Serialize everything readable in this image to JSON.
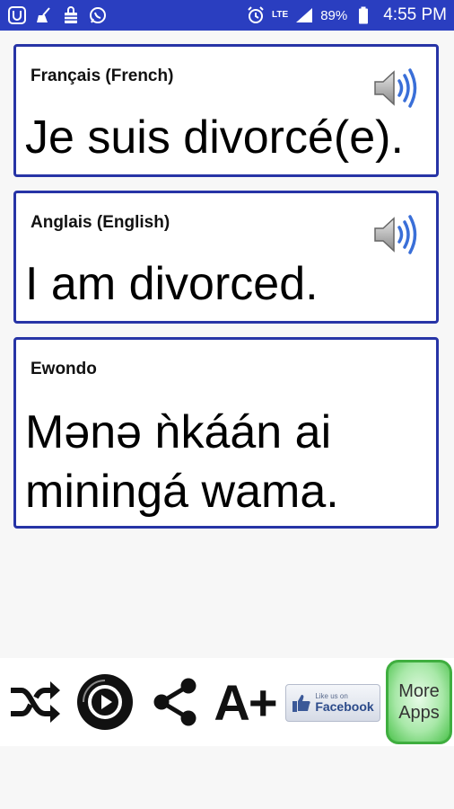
{
  "status_bar": {
    "battery_percent": "89%",
    "network": "LTE",
    "time": "4:55 PM"
  },
  "cards": [
    {
      "label": "Français (French)",
      "text": "Je suis divorcé(e).",
      "has_audio": true
    },
    {
      "label": "Anglais (English)",
      "text": "I am divorced.",
      "has_audio": true
    },
    {
      "label": "Ewondo",
      "text_line1": "Mənə ǹkáán ai",
      "text_line2": "miningá wama.",
      "has_audio": false
    }
  ],
  "toolbar": {
    "facebook_small": "Like us on",
    "facebook_big": "Facebook",
    "more_apps_line1": "More",
    "more_apps_line2": "Apps",
    "font_size_label": "A+"
  },
  "colors": {
    "status_bar": "#2a3ec0",
    "card_border": "#2734a6",
    "more_apps_green": "#3fae3f"
  }
}
